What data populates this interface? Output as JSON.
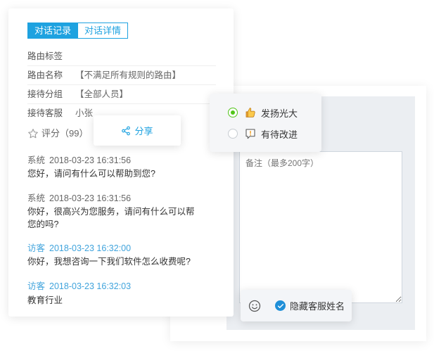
{
  "tabs": {
    "records": "对话记录",
    "details": "对话详情"
  },
  "info": [
    {
      "label": "路由标签",
      "value": ""
    },
    {
      "label": "路由名称",
      "value": "【不满足所有规则的路由】"
    },
    {
      "label": "接待分组",
      "value": "【全部人员】"
    },
    {
      "label": "接待客服",
      "value": "小张"
    }
  ],
  "rating": {
    "text": "评分（99）"
  },
  "share": {
    "label": "分享"
  },
  "messages": [
    {
      "sender": "系统",
      "time": "2018-03-23 16:31:56",
      "text": "您好，请问有什么可以帮助到您?"
    },
    {
      "sender": "系统",
      "time": "2018-03-23 16:31:56",
      "text": "你好，很高兴为您服务，请问有什么可以帮您的吗?"
    },
    {
      "sender": "访客",
      "time": "2018-03-23 16:32:00",
      "text": "你好，我想咨询一下我们软件怎么收费呢?"
    },
    {
      "sender": "访客",
      "time": "2018-03-23 16:32:03",
      "text": "教育行业"
    }
  ],
  "options": {
    "praise": "发扬光大",
    "improve": "有待改进",
    "selected": "praise"
  },
  "remark": {
    "placeholder": "备注（最多200字）"
  },
  "toolbar": {
    "hide_name": "隐藏客服姓名"
  },
  "colors": {
    "accent": "#1ea2e0",
    "visitor": "#3fa3dc",
    "radio_selected": "#52c41a",
    "check": "#1f8fd8"
  }
}
